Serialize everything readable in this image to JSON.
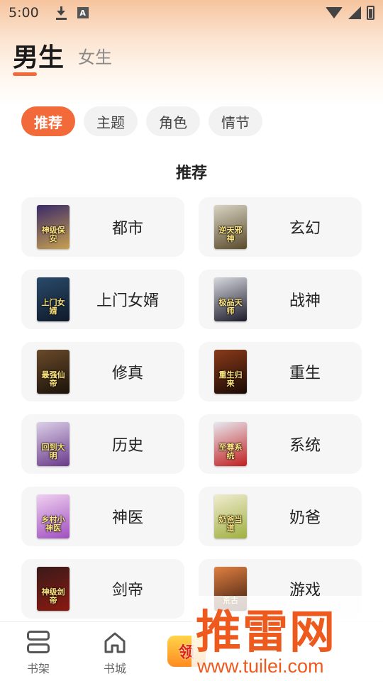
{
  "status_bar": {
    "time": "5:00",
    "left_icons": [
      "download-icon",
      "a-icon"
    ],
    "right_icons": [
      "wifi-icon",
      "signal-icon",
      "battery-icon"
    ]
  },
  "gender_tabs": [
    {
      "label": "男生",
      "active": true
    },
    {
      "label": "女生",
      "active": false
    }
  ],
  "chips": [
    {
      "label": "推荐",
      "active": true
    },
    {
      "label": "主题",
      "active": false
    },
    {
      "label": "角色",
      "active": false
    },
    {
      "label": "情节",
      "active": false
    }
  ],
  "section_title": "推荐",
  "categories": [
    {
      "label": "都市",
      "cover_text": "神级保安",
      "cover_colors": [
        "#3a2a6a",
        "#c8a050"
      ]
    },
    {
      "label": "玄幻",
      "cover_text": "逆天邪神",
      "cover_colors": [
        "#d9d4c4",
        "#5a4a2a"
      ]
    },
    {
      "label": "上门女婿",
      "cover_text": "上门女婿",
      "cover_colors": [
        "#2a4a6a",
        "#0f1a2a"
      ]
    },
    {
      "label": "战神",
      "cover_text": "极品天师",
      "cover_colors": [
        "#d8d8e0",
        "#1a1a2a"
      ]
    },
    {
      "label": "修真",
      "cover_text": "最强仙帝",
      "cover_colors": [
        "#6a4a2a",
        "#1a120a"
      ]
    },
    {
      "label": "重生",
      "cover_text": "重生归来",
      "cover_colors": [
        "#8a3a1a",
        "#1a0a05"
      ]
    },
    {
      "label": "历史",
      "cover_text": "回到大明",
      "cover_colors": [
        "#dcd0e8",
        "#6a3a8a"
      ]
    },
    {
      "label": "系统",
      "cover_text": "至尊系统",
      "cover_colors": [
        "#e8e8f0",
        "#c02020"
      ]
    },
    {
      "label": "神医",
      "cover_text": "乡村小神医",
      "cover_colors": [
        "#f0d0f0",
        "#a050c0"
      ]
    },
    {
      "label": "奶爸",
      "cover_text": "奶爸当道",
      "cover_colors": [
        "#f0ecd0",
        "#a0b040"
      ]
    },
    {
      "label": "剑帝",
      "cover_text": "神级剑帝",
      "cover_colors": [
        "#3a1a1a",
        "#8a1a10"
      ]
    },
    {
      "label": "游戏",
      "cover_text": "荒古",
      "cover_colors": [
        "#e08040",
        "#3a1a10"
      ]
    }
  ],
  "bottom_nav": [
    {
      "label": "书架",
      "icon": "shelf-icon"
    },
    {
      "label": "书城",
      "icon": "store-icon"
    },
    {
      "label": "领",
      "icon": "reward-icon"
    }
  ],
  "watermark": {
    "main": "推雷网",
    "url": "www.tuilei.com"
  }
}
